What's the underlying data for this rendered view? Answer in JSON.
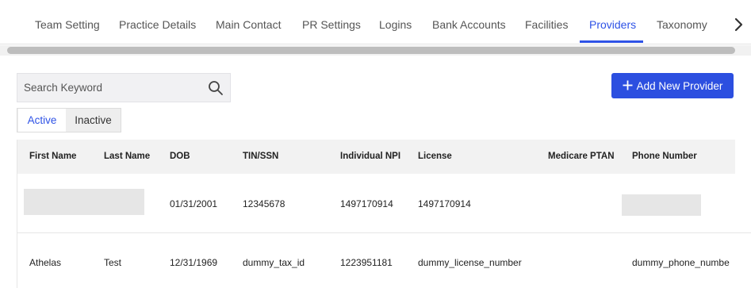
{
  "tabs": [
    {
      "label": "Team Setting",
      "active": false
    },
    {
      "label": "Practice Details",
      "active": false
    },
    {
      "label": "Main Contact",
      "active": false
    },
    {
      "label": "PR Settings",
      "active": false
    },
    {
      "label": "Logins",
      "active": false
    },
    {
      "label": "Bank Accounts",
      "active": false
    },
    {
      "label": "Facilities",
      "active": false
    },
    {
      "label": "Providers",
      "active": true
    },
    {
      "label": "Taxonomy",
      "active": false
    }
  ],
  "tab_next_icon": "chevron-right-icon",
  "search": {
    "placeholder": "Search Keyword",
    "value": "",
    "icon": "search-icon"
  },
  "add_button": {
    "label": "Add New Provider",
    "icon": "plus-icon"
  },
  "status_filter": {
    "options": [
      "Active",
      "Inactive"
    ],
    "selected": "Active"
  },
  "table": {
    "columns": [
      "First Name",
      "Last Name",
      "DOB",
      "TIN/SSN",
      "Individual NPI",
      "License",
      "Medicare PTAN",
      "Phone Number"
    ],
    "rows": [
      {
        "first_name": "",
        "last_name": "",
        "dob": "01/31/2001",
        "tin_ssn": "12345678",
        "npi": "1497170914",
        "license": "1497170914",
        "medicare_ptan": "",
        "phone": ""
      },
      {
        "first_name": "Athelas",
        "last_name": "Test",
        "dob": "12/31/1969",
        "tin_ssn": "dummy_tax_id",
        "npi": "1223951181",
        "license": "dummy_license_number",
        "medicare_ptan": "",
        "phone": "dummy_phone_numbe"
      }
    ]
  },
  "colors": {
    "accent": "#2e52e6",
    "button": "#2c4fe0",
    "header_bg": "#f2f2f2"
  }
}
